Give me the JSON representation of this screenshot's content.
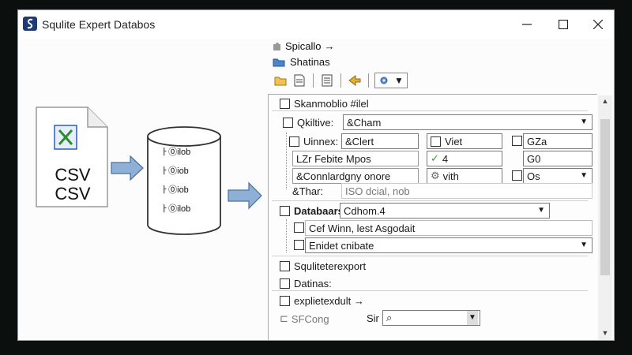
{
  "window": {
    "title": "Squlite Expert Databos"
  },
  "nav": {
    "top_link": "Spicallo",
    "top_link_arrow": "→",
    "folder_label": "Shatinas"
  },
  "illustration": {
    "csv_line1": "CSV",
    "csv_line2": "CSV",
    "db_rows": [
      "ㅏ⓪ilob",
      "ㅏ⓪iob",
      "ㅏ⓪iob",
      "ㅏ⓪ilob"
    ]
  },
  "panel": {
    "header_label": "Skanmoblio #ilel",
    "output": {
      "label": "Qkiltive:",
      "value": "&Cham"
    },
    "union": {
      "label": "Uinnex:",
      "value": "&Clert"
    },
    "view_value": "Viet",
    "giza_value": "GZa",
    "feb": {
      "label": "LZr Febite",
      "value": "Mpos"
    },
    "check_value": "4",
    "g0_value": "G0",
    "conn": {
      "label": "&Connlardgny onore"
    },
    "with_value": "vith",
    "os_value": "Os",
    "thar": {
      "label": "&Thar:",
      "value": "ISO dcial, nob"
    },
    "databases": {
      "label": "Databaars:",
      "value": "Cdhom.4"
    },
    "cef": {
      "value": "Cef Winn, lest Asgodait"
    },
    "enidet": {
      "value": "Enidet cnibate"
    },
    "squlite_label": "Squliteterexport",
    "datinas_label": "Datinas:",
    "export_label": "explietexdult",
    "export_arrow": "→",
    "sfcong_label": "SFCong",
    "sir_label": "Sir"
  },
  "colors": {
    "arrow_blue": "#8fb0d6",
    "db_fill": "#ffffff",
    "icon_navy": "#1f3b73"
  }
}
